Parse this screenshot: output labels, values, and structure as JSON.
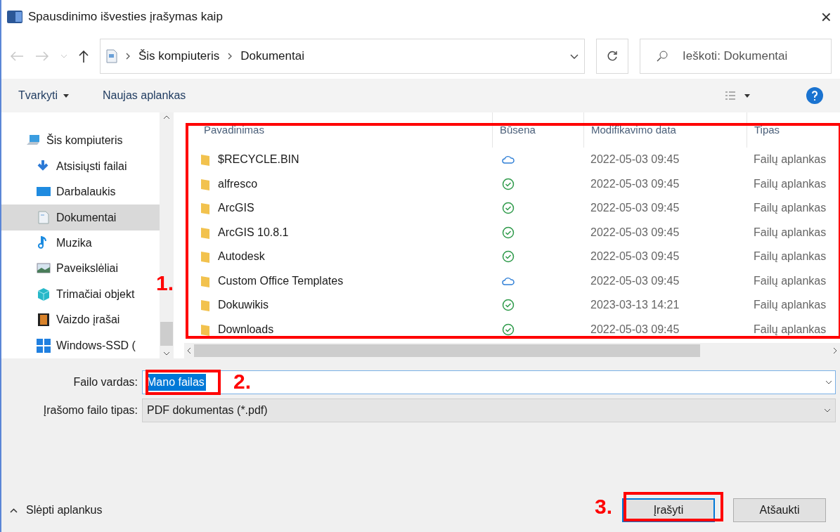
{
  "window": {
    "title": "Spausdinimo išvesties įrašymas kaip",
    "close": "×"
  },
  "address": {
    "path": [
      "Šis kompiuteris",
      "Dokumentai"
    ],
    "search_placeholder": "Ieškoti: Dokumentai"
  },
  "toolbar": {
    "organize": "Tvarkyti",
    "new_folder": "Naujas aplankas"
  },
  "sidebar": {
    "items": [
      {
        "label": "Šis kompiuteris",
        "kind": "computer",
        "selected": false
      },
      {
        "label": "Atsisiųsti failai",
        "kind": "download",
        "selected": false
      },
      {
        "label": "Darbalaukis",
        "kind": "desktop",
        "selected": false
      },
      {
        "label": "Dokumentai",
        "kind": "document",
        "selected": true
      },
      {
        "label": "Muzika",
        "kind": "music",
        "selected": false
      },
      {
        "label": "Paveikslėliai",
        "kind": "picture",
        "selected": false
      },
      {
        "label": "Trimačiai objekt",
        "kind": "cube",
        "selected": false
      },
      {
        "label": "Vaizdo įrašai",
        "kind": "video",
        "selected": false
      },
      {
        "label": "Windows-SSD (",
        "kind": "drive",
        "selected": false
      }
    ]
  },
  "table": {
    "columns": [
      "Pavadinimas",
      "Būsena",
      "Modifikavimo data",
      "Tipas"
    ],
    "rows": [
      {
        "name": "$RECYCLE.BIN",
        "synced": false,
        "date": "2022-05-03 09:45",
        "type": "Failų aplankas"
      },
      {
        "name": "alfresco",
        "synced": true,
        "date": "2022-05-03 09:45",
        "type": "Failų aplankas"
      },
      {
        "name": "ArcGIS",
        "synced": true,
        "date": "2022-05-03 09:45",
        "type": "Failų aplankas"
      },
      {
        "name": "ArcGIS 10.8.1",
        "synced": true,
        "date": "2022-05-03 09:45",
        "type": "Failų aplankas"
      },
      {
        "name": "Autodesk",
        "synced": true,
        "date": "2022-05-03 09:45",
        "type": "Failų aplankas"
      },
      {
        "name": "Custom Office Templates",
        "synced": false,
        "date": "2022-05-03 09:45",
        "type": "Failų aplankas"
      },
      {
        "name": "Dokuwikis",
        "synced": true,
        "date": "2023-03-13 14:21",
        "type": "Failų aplankas"
      },
      {
        "name": "Downloads",
        "synced": true,
        "date": "2022-05-03 09:45",
        "type": "Failų aplankas"
      }
    ]
  },
  "form": {
    "filename_label": "Failo vardas:",
    "filename": "Mano failas",
    "filetype_label": "Įrašomo failo tipas:",
    "filetype": "PDF dokumentas (*.pdf)"
  },
  "footer": {
    "hide_folders": "Slėpti aplankus",
    "buttons": [
      {
        "label": "Įrašyti",
        "default": true
      },
      {
        "label": "Atšaukti",
        "default": false
      }
    ]
  },
  "annotations": [
    "1.",
    "2.",
    "3."
  ]
}
